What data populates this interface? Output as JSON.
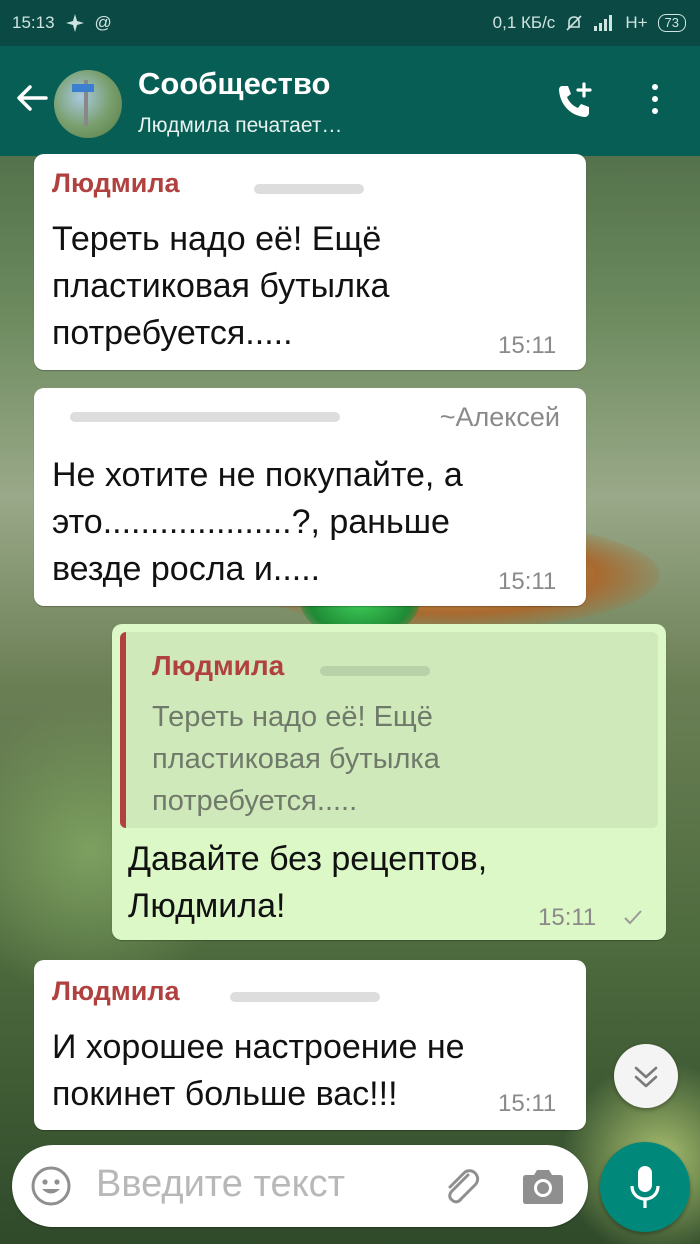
{
  "status_bar": {
    "time": "15:13",
    "speed": "0,1 КБ/с",
    "network": "H+",
    "battery": "73"
  },
  "header": {
    "title": "Сообщество",
    "subtitle": "Людмила печатает…"
  },
  "messages": [
    {
      "sender": "Людмила",
      "lines": [
        "Тереть надо её! Ещё",
        "пластиковая бутылка",
        "потребуется....."
      ],
      "time": "15:11"
    },
    {
      "sender": "~Алексей",
      "lines": [
        "Не хотите не покупайте, а",
        "это....................?, раньше",
        "везде росла и....."
      ],
      "time": "15:11"
    },
    {
      "quote_sender": "Людмила",
      "quote_lines": [
        "Тереть надо её! Ещё",
        "пластиковая бутылка",
        "потребуется....."
      ],
      "lines": [
        "Давайте без рецептов,",
        "Людмила!"
      ],
      "time": "15:11"
    },
    {
      "sender": "Людмила",
      "lines": [
        "И хорошее настроение не",
        "покинет больше вас!!!"
      ],
      "time": "15:11"
    }
  ],
  "input": {
    "placeholder": "Введите текст"
  },
  "colors": {
    "header": "#075e54",
    "status_bar": "#0b4a44",
    "outgoing_bubble": "#dcf8c6",
    "sender_name": "#b0413e",
    "mic_button": "#00897b"
  },
  "icons": [
    "back-arrow-icon",
    "add-call-icon",
    "more-vert-icon",
    "chevron-down-icon",
    "emoji-icon",
    "attach-icon",
    "camera-icon",
    "mic-icon",
    "check-icon"
  ]
}
